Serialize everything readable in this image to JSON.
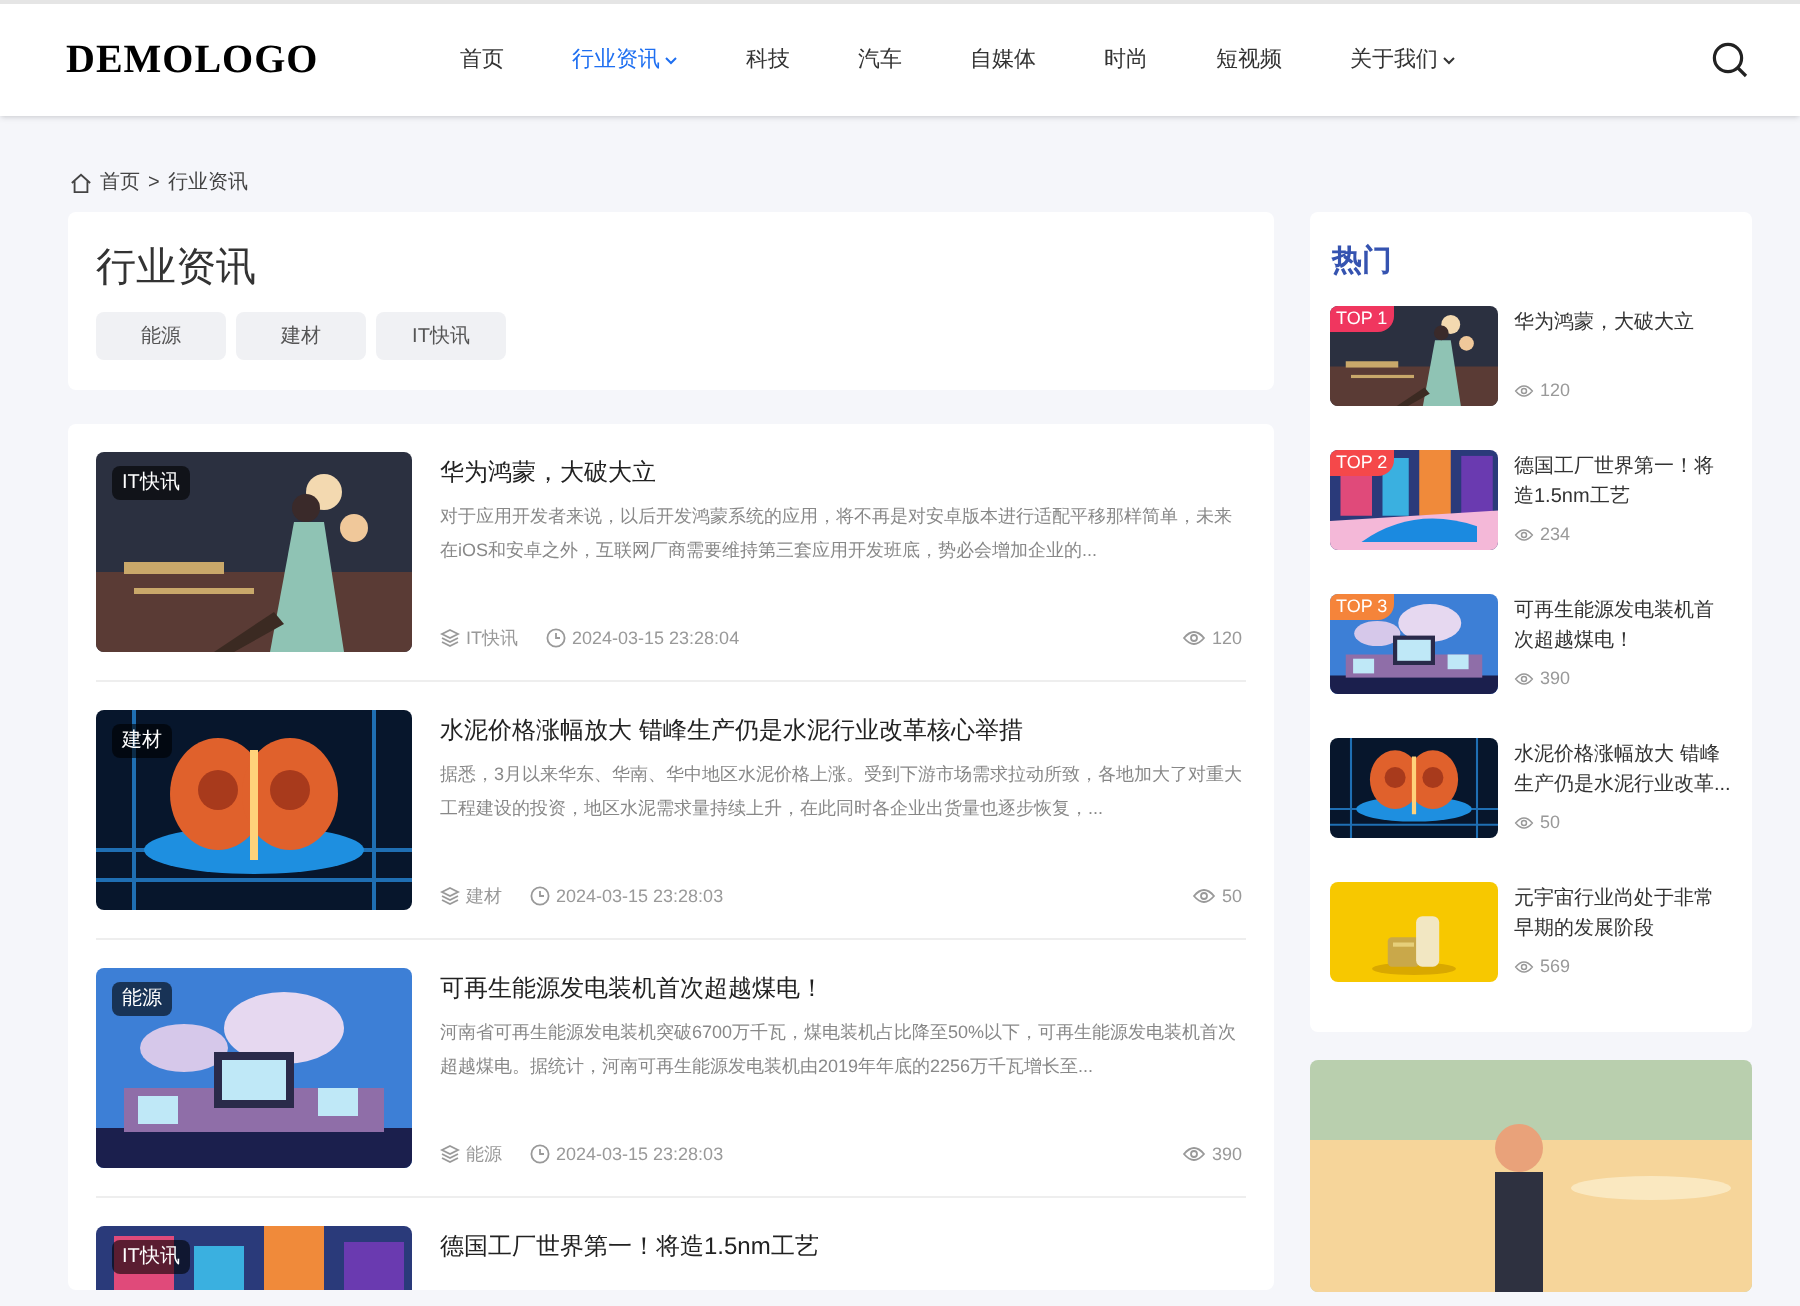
{
  "header": {
    "logo": "DEMOLOGO",
    "nav": [
      {
        "label": "首页",
        "selected": false,
        "has_menu": false
      },
      {
        "label": "行业资讯",
        "selected": true,
        "has_menu": true
      },
      {
        "label": "科技",
        "selected": false,
        "has_menu": false
      },
      {
        "label": "汽车",
        "selected": false,
        "has_menu": false
      },
      {
        "label": "自媒体",
        "selected": false,
        "has_menu": false
      },
      {
        "label": "时尚",
        "selected": false,
        "has_menu": false
      },
      {
        "label": "短视频",
        "selected": false,
        "has_menu": false
      },
      {
        "label": "关于我们",
        "selected": false,
        "has_menu": true
      }
    ]
  },
  "breadcrumb": [
    "首页",
    ">",
    "行业资讯"
  ],
  "category": {
    "title": "行业资讯",
    "tags": [
      "能源",
      "建材",
      "IT快讯"
    ]
  },
  "articles": [
    {
      "tag": "IT快讯",
      "title": "华为鸿蒙，大破大立",
      "excerpt": "对于应用开发者来说，以后开发鸿蒙系统的应用，将不再是对安卓版本进行适配平移那样简单，未来在iOS和安卓之外，互联网厂商需要维持第三套应用开发班底，势必会增加企业的...",
      "category": "IT快讯",
      "date": "2024-03-15 23:28:04",
      "views": "120"
    },
    {
      "tag": "建材",
      "title": "水泥价格涨幅放大 错峰生产仍是水泥行业改革核心举措",
      "excerpt": "据悉，3月以来华东、华南、华中地区水泥价格上涨。受到下游市场需求拉动所致，各地加大了对重大工程建设的投资，地区水泥需求量持续上升，在此同时各企业出货量也逐步恢复，...",
      "category": "建材",
      "date": "2024-03-15 23:28:03",
      "views": "50"
    },
    {
      "tag": "能源",
      "title": "可再生能源发电装机首次超越煤电！",
      "excerpt": "河南省可再生能源发电装机突破6700万千瓦，煤电装机占比降至50%以下，可再生能源发电装机首次超越煤电。据统计，河南可再生能源发电装机由2019年年底的2256万千瓦增长至...",
      "category": "能源",
      "date": "2024-03-15 23:28:03",
      "views": "390"
    },
    {
      "tag": "IT快讯",
      "title": "德国工厂世界第一！将造1.5nm工艺"
    }
  ],
  "hot": {
    "title": "热门",
    "items": [
      {
        "rank": "TOP 1",
        "title": "华为鸿蒙，大破大立",
        "views": "120",
        "color": "#f0365f"
      },
      {
        "rank": "TOP 2",
        "title": "德国工厂世界第一！将造1.5nm工艺",
        "views": "234",
        "color": "#f5484a"
      },
      {
        "rank": "TOP 3",
        "title": "可再生能源发电装机首次超越煤电！",
        "views": "390",
        "color": "#f5843a"
      },
      {
        "title": "水泥价格涨幅放大 错峰生产仍是水泥行业改革...",
        "views": "50"
      },
      {
        "title": "元宇宙行业尚处于非常早期的发展阶段",
        "views": "569"
      }
    ]
  }
}
